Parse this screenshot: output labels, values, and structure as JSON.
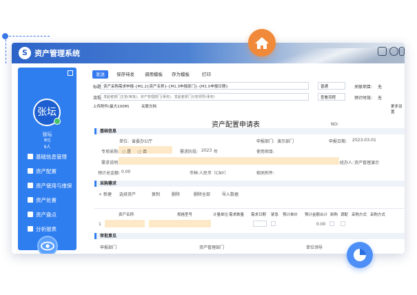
{
  "app": {
    "title": "资产管理系统"
  },
  "user": {
    "avatar": "张坛",
    "name": "张坛",
    "dept": "单位",
    "count": "9人"
  },
  "menu": [
    "基础信息管理",
    "资产配置",
    "资产使用与维保",
    "资产处置",
    "资产盘点",
    "分析报表"
  ],
  "toolbar": {
    "send": "发送",
    "save": "保存待发",
    "template": "调用模板",
    "save_template": "存为模板",
    "print": "打印"
  },
  "header": {
    "title_label": "标题:",
    "title_value": "资产采购需求申报-{M1.2{资产名称}-{M1.3申报部门}-{M1.0申报日期}",
    "flow_label": "流程:",
    "flow_value": "发起者部门主管(审批)、资产管理部门(事务)、发起者部门分管领导(事务)",
    "priority": "普通",
    "related_label": "关联项目:",
    "related_value": "无",
    "view_flow": "查看流程",
    "deadline_label": "预计时效:",
    "deadline_value": "无",
    "upload": "上传附件(最大100M)",
    "doc": "关联文档",
    "more": "更多设置"
  },
  "form": {
    "title": "资产配置申请表",
    "no_label": "NO:",
    "section_basic": "基础信息",
    "unit_label": "单位:",
    "unit_value": "省委办公厅",
    "dept_label": "申报部门:",
    "dept_value": "演示部门",
    "date_label": "申报日期:",
    "date_value": "2023-03-01",
    "special_label": "专项采购:",
    "yes": "是",
    "no": "否",
    "stage_label": "需求阶段:",
    "year_value": "2023",
    "year_unit": "年",
    "project_label": "使用项目:",
    "desc_label": "需求说明:",
    "handler_label": "经办人:",
    "handler_value": "资产管理演示",
    "budget_label": "预计总金额:",
    "budget_value": "0.00",
    "currency_label": "币种:",
    "currency_value": "人民币（CNY）",
    "attach_label": "相关附件:"
  },
  "purchase": {
    "section": "采购需求",
    "add": "新建",
    "select": "选择资产",
    "copy": "复制",
    "delete": "删除",
    "delete_all": "删除全部",
    "import": "导入数据",
    "columns": [
      "资产名称",
      "规格型号",
      "计量单位",
      "需求数量",
      "需求日期",
      "紧急",
      "预计单价",
      "预计金额合计",
      "新购",
      "调配",
      "采购方式",
      "采购方式"
    ],
    "row_index": "1",
    "row_amount": "0.00"
  },
  "approval": {
    "section": "审批意见",
    "c1": "申报部门",
    "c2": "资产管理部门",
    "c3": "单位领导"
  }
}
